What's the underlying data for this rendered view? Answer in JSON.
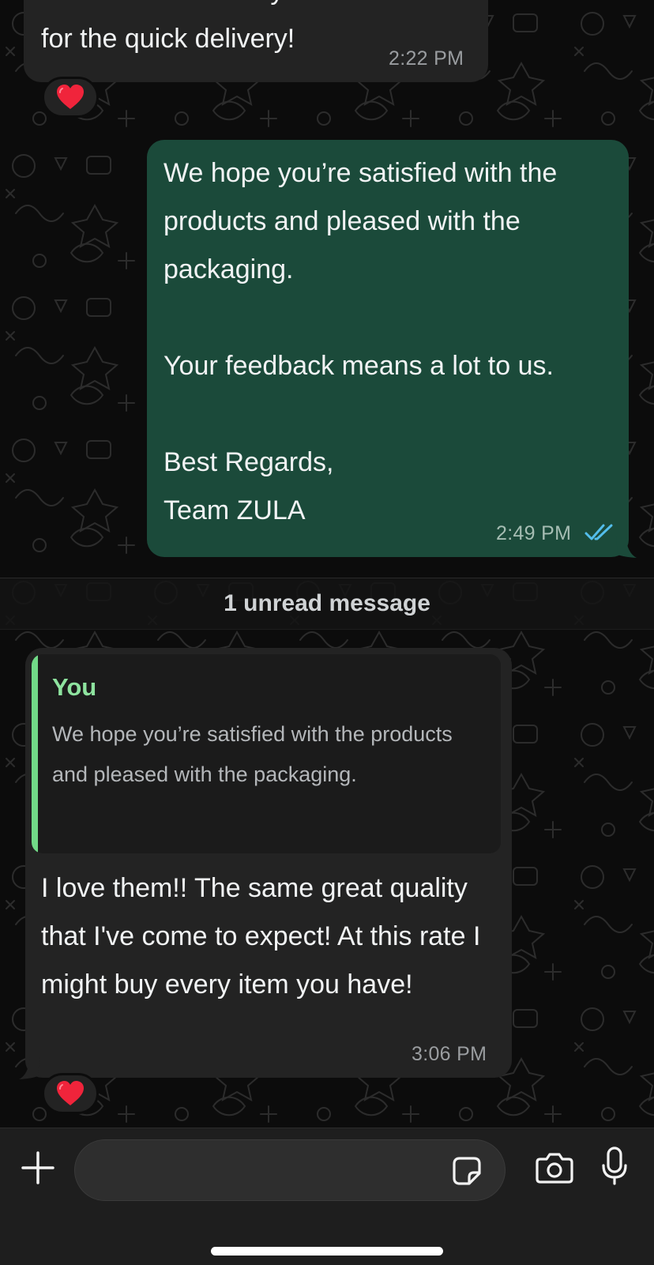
{
  "messages": [
    {
      "id": "m1",
      "direction": "incoming",
      "text_partial_top": "Received it. Thank you so much",
      "text": "for the quick delivery!",
      "time": "2:22 PM",
      "reaction": "❤️"
    },
    {
      "id": "m2",
      "direction": "outgoing",
      "text": "We hope you’re satisfied with the products and pleased with the packaging.\n\nYour feedback means a lot to us.\n\nBest Regards,\nTeam ZULA",
      "time": "2:49 PM",
      "status": "read"
    },
    {
      "id": "m3",
      "direction": "incoming",
      "quote": {
        "author": "You",
        "text": "We hope you’re satisfied with the products and pleased with the packaging."
      },
      "text": "I love them!! The same great quality that I've come to expect! At this rate I might buy every item you have!",
      "time": "3:06 PM",
      "reaction": "❤️"
    }
  ],
  "divider": {
    "label": "1 unread message"
  },
  "composer": {
    "placeholder": "",
    "icons": [
      "plus-icon",
      "sticker-icon",
      "camera-icon",
      "microphone-icon"
    ]
  },
  "colors": {
    "outgoing_bubble": "#1b4a3a",
    "incoming_bubble": "#232323",
    "quote_accent": "#71d987",
    "read_ticks": "#53bdeb"
  }
}
